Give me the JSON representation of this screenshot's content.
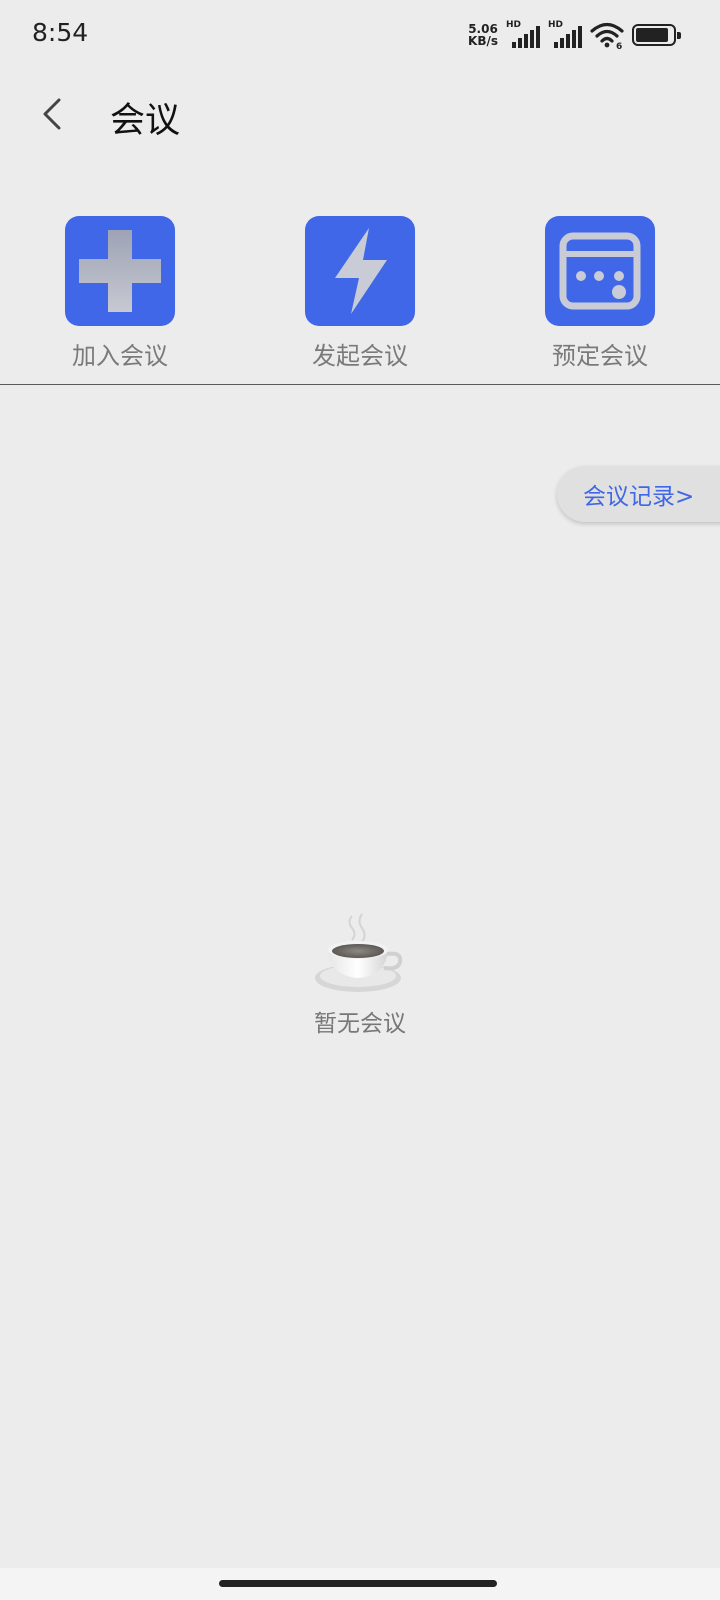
{
  "status_bar": {
    "time": "8:54",
    "net_speed_value": "5.06",
    "net_speed_unit": "KB/s",
    "sim1_label": "HD",
    "sim2_label": "HD",
    "wifi_badge": "6",
    "icons": [
      "signal-icon",
      "wifi-icon",
      "battery-icon"
    ]
  },
  "header": {
    "title": "会议",
    "back_icon": "chevron-left-icon"
  },
  "actions": [
    {
      "label": "加入会议",
      "icon": "plus-icon"
    },
    {
      "label": "发起会议",
      "icon": "lightning-icon"
    },
    {
      "label": "预定会议",
      "icon": "calendar-icon"
    }
  ],
  "records_link": "会议记录>",
  "empty_state": {
    "text": "暂无会议",
    "icon": "coffee-cup-icon"
  },
  "colors": {
    "accent": "#3f67e8",
    "background": "#ececec",
    "label_gray": "#7a7a7a"
  }
}
